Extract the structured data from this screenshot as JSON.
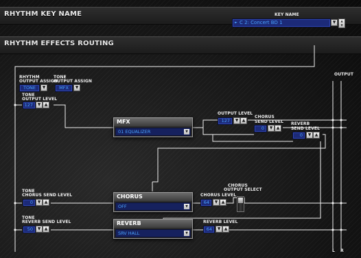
{
  "header": {
    "title": "RHYTHM KEY NAME",
    "key_name_label": "KEY NAME",
    "key_name_value": "C 2:  Concert BD 1"
  },
  "routing": {
    "title": "RHYTHM EFFECTS ROUTING",
    "output_label": "OUTPUT",
    "output_l": "L",
    "output_r": "R",
    "rhythm_output_assign": {
      "label_line1": "RHYTHM",
      "label_line2": "OUTPUT ASSIGN",
      "value": "TONE"
    },
    "tone_output_assign": {
      "label_line1": "TONE",
      "label_line2": "OUTPUT ASSIGN",
      "value": "MFX"
    },
    "tone_output_level": {
      "label_line1": "TONE",
      "label_line2": "OUTPUT LEVEL",
      "value": "127"
    },
    "tone_chorus_send_level": {
      "label_line1": "TONE",
      "label_line2": "CHORUS SEND LEVEL",
      "value": "0"
    },
    "tone_reverb_send_level": {
      "label_line1": "TONE",
      "label_line2": "REVERB SEND LEVEL",
      "value": "50"
    },
    "mfx": {
      "title": "MFX",
      "type": "01 EQUALIZER"
    },
    "mfx_output_level": {
      "label": "OUTPUT LEVEL",
      "value": "127"
    },
    "mfx_chorus_send_level": {
      "label_line1": "CHORUS",
      "label_line2": "SEND LEVEL",
      "value": "0"
    },
    "mfx_reverb_send_level": {
      "label_line1": "REVERB",
      "label_line2": "SEND LEVEL",
      "value": "0"
    },
    "chorus": {
      "title": "CHORUS",
      "type": "OFF"
    },
    "chorus_level": {
      "label": "CHORUS LEVEL",
      "value": "64"
    },
    "chorus_output_select": {
      "label_line1": "CHORUS",
      "label_line2": "OUTPUT SELECT"
    },
    "reverb": {
      "title": "REVERB",
      "type": "SRV HALL"
    },
    "reverb_level": {
      "label": "REVERB LEVEL",
      "value": "64"
    }
  },
  "colors": {
    "field_bg": "#1c2a78",
    "field_text": "#4aa3ff",
    "background": "#141414"
  },
  "icons": {
    "arrow_down": "▼",
    "arrow_up": "▲",
    "key_marker": "►"
  }
}
